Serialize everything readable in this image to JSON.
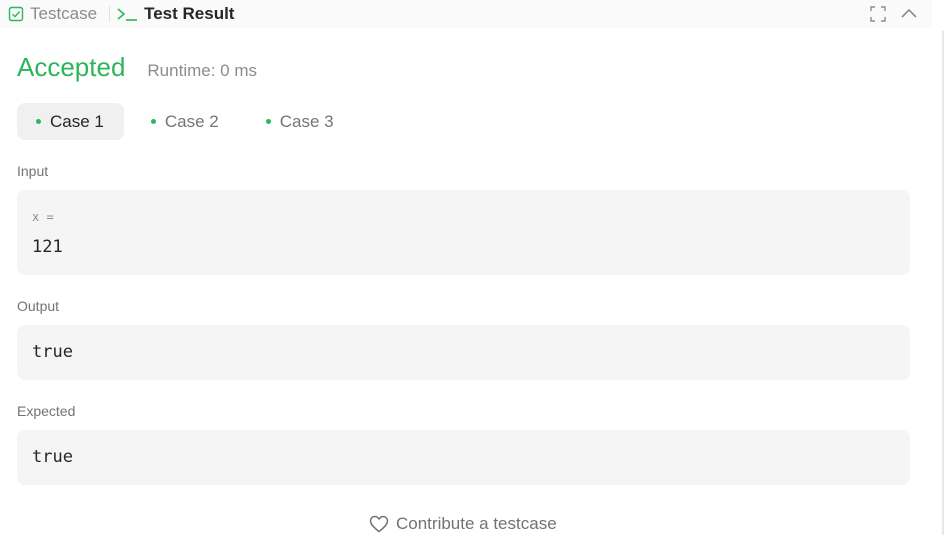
{
  "tabs": [
    {
      "label": "Testcase",
      "icon": "check-square-icon"
    },
    {
      "label": "Test Result",
      "icon": "terminal-icon"
    }
  ],
  "header_actions": [
    {
      "icon": "fullscreen-icon"
    },
    {
      "icon": "chevron-up-icon"
    }
  ],
  "result": {
    "status": "Accepted",
    "runtime": "Runtime: 0 ms"
  },
  "cases": [
    {
      "label": "Case 1",
      "selected": true
    },
    {
      "label": "Case 2",
      "selected": false
    },
    {
      "label": "Case 3",
      "selected": false
    }
  ],
  "input": {
    "label": "Input",
    "var_name": "x =",
    "value": "121"
  },
  "output": {
    "label": "Output",
    "value": "true"
  },
  "expected": {
    "label": "Expected",
    "value": "true"
  },
  "contribute": {
    "label": "Contribute a testcase",
    "icon": "heart-icon"
  },
  "colors": {
    "accent_green": "#2db55d",
    "panel_bg": "#f5f5f5",
    "muted_text": "#8c8c8c"
  }
}
